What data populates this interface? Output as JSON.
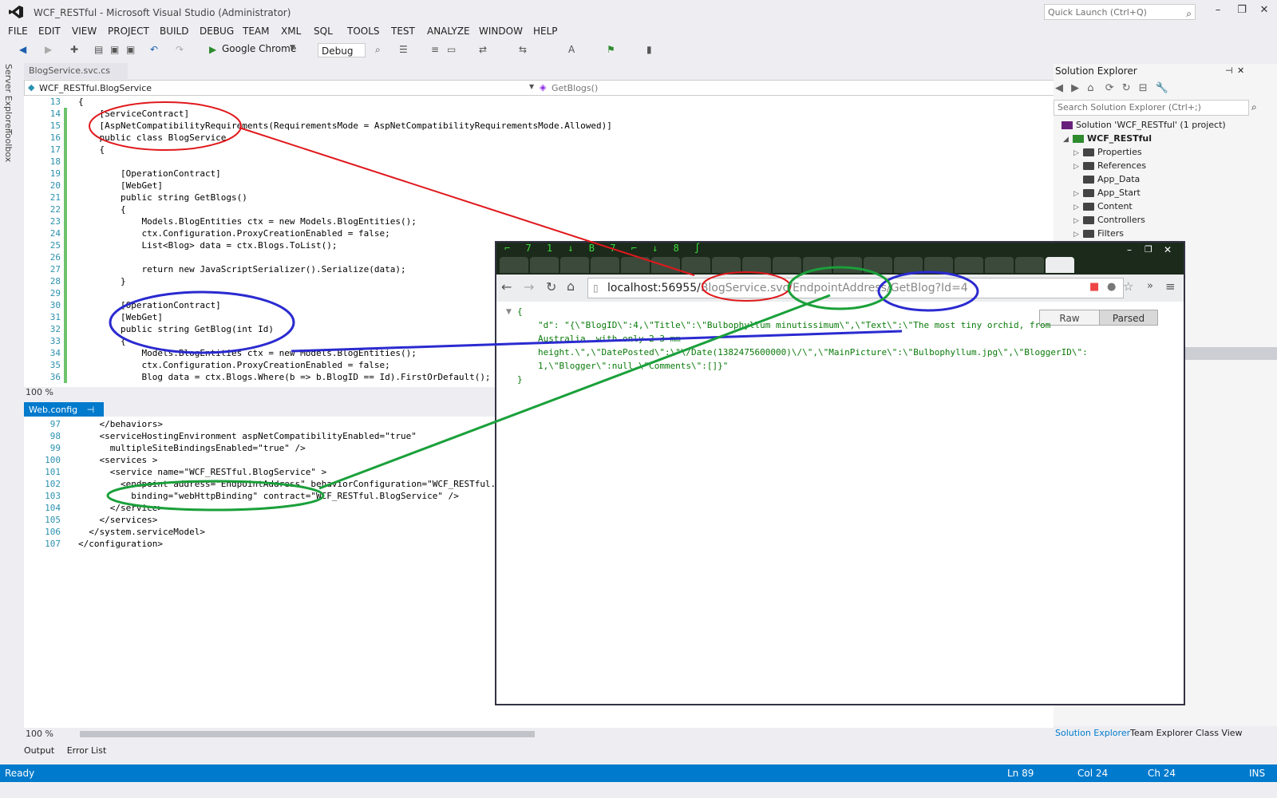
{
  "window": {
    "title": "WCF_RESTful - Microsoft Visual Studio (Administrator)",
    "quick_launch_placeholder": "Quick Launch (Ctrl+Q)"
  },
  "menu": [
    "FILE",
    "EDIT",
    "VIEW",
    "PROJECT",
    "BUILD",
    "DEBUG",
    "TEAM",
    "XML",
    "SQL",
    "TOOLS",
    "TEST",
    "ANALYZE",
    "WINDOW",
    "HELP"
  ],
  "toolbar": {
    "run_target": "Google Chrome",
    "configuration": "Debug"
  },
  "side_labels": [
    "Server Explorer",
    "Toolbox"
  ],
  "editor1": {
    "tab_label": "BlogService.svc.cs",
    "nav_left": "WCF_RESTful.BlogService",
    "nav_right": "GetBlogs()",
    "zoom": "100 %",
    "lines": [
      {
        "n": "13",
        "t": "{"
      },
      {
        "n": "14",
        "t": "    [ServiceContract]"
      },
      {
        "n": "15",
        "t": "    [AspNetCompatibilityRequirements(RequirementsMode = AspNetCompatibilityRequirementsMode.Allowed)]"
      },
      {
        "n": "16",
        "t": "    public class BlogService"
      },
      {
        "n": "17",
        "t": "    {"
      },
      {
        "n": "18",
        "t": ""
      },
      {
        "n": "19",
        "t": "        [OperationContract]"
      },
      {
        "n": "20",
        "t": "        [WebGet]"
      },
      {
        "n": "21",
        "t": "        public string GetBlogs()"
      },
      {
        "n": "22",
        "t": "        {"
      },
      {
        "n": "23",
        "t": "            Models.BlogEntities ctx = new Models.BlogEntities();"
      },
      {
        "n": "24",
        "t": "            ctx.Configuration.ProxyCreationEnabled = false;"
      },
      {
        "n": "25",
        "t": "            List<Blog> data = ctx.Blogs.ToList();"
      },
      {
        "n": "26",
        "t": ""
      },
      {
        "n": "27",
        "t": "            return new JavaScriptSerializer().Serialize(data);"
      },
      {
        "n": "28",
        "t": "        }"
      },
      {
        "n": "29",
        "t": ""
      },
      {
        "n": "30",
        "t": "        [OperationContract]"
      },
      {
        "n": "31",
        "t": "        [WebGet]"
      },
      {
        "n": "32",
        "t": "        public string GetBlog(int Id)"
      },
      {
        "n": "33",
        "t": "        {"
      },
      {
        "n": "34",
        "t": "            Models.BlogEntities ctx = new Models.BlogEntities();"
      },
      {
        "n": "35",
        "t": "            ctx.Configuration.ProxyCreationEnabled = false;"
      },
      {
        "n": "36",
        "t": "            Blog data = ctx.Blogs.Where(b => b.BlogID == Id).FirstOrDefault();"
      }
    ]
  },
  "editor2": {
    "tab_label": "Web.config",
    "zoom": "100 %",
    "lines": [
      {
        "n": "97",
        "t": "    </behaviors>"
      },
      {
        "n": "98",
        "t": "    <serviceHostingEnvironment aspNetCompatibilityEnabled=\"true\""
      },
      {
        "n": "99",
        "t": "      multipleSiteBindingsEnabled=\"true\" />"
      },
      {
        "n": "100",
        "t": "    <services >"
      },
      {
        "n": "101",
        "t": "      <service name=\"WCF_RESTful.BlogService\" >"
      },
      {
        "n": "102",
        "t": "        <endpoint address=\"EndpointAddress\" behaviorConfiguration=\"WCF_RESTful.E"
      },
      {
        "n": "103",
        "t": "          binding=\"webHttpBinding\" contract=\"WCF_RESTful.BlogService\" />"
      },
      {
        "n": "104",
        "t": "      </service>"
      },
      {
        "n": "105",
        "t": "    </services>"
      },
      {
        "n": "106",
        "t": "  </system.serviceModel>"
      },
      {
        "n": "107",
        "t": "</configuration>"
      }
    ]
  },
  "output_tabs": [
    "Output",
    "Error List"
  ],
  "solution_explorer": {
    "title": "Solution Explorer",
    "search_placeholder": "Search Solution Explorer (Ctrl+;)",
    "solution": "Solution 'WCF_RESTful' (1 project)",
    "project": "WCF_RESTful",
    "items": [
      "Properties",
      "References",
      "App_Data",
      "App_Start",
      "Content",
      "Controllers",
      "Filters"
    ],
    "bottom_tabs": [
      "Solution Explorer",
      "Team Explorer",
      "Class View"
    ]
  },
  "browser": {
    "url_host": "localhost:56955/",
    "url_path": "BlogService.svc/EndpointAddress/GetBlog?Id=4",
    "raw_label": "Raw",
    "parsed_label": "Parsed",
    "json_lines": [
      "{",
      "\"d\": \"{\\\"BlogID\\\":4,\\\"Title\\\":\\\"Bulbophyllum minutissimum\\\",\\\"Text\\\":\\\"The most tiny orchid, from",
      "Australia, with only 2-3 mm",
      "height.\\\",\\\"DatePosted\\\":\\\"\\/Date(1382475600000)\\/\\\",\\\"MainPicture\\\":\\\"Bulbophyllum.jpg\\\",\\\"BloggerID\\\":",
      "1,\\\"Blogger\\\":null,\\\"Comments\\\":[]}\"",
      "}"
    ]
  },
  "status_bar": {
    "state": "Ready",
    "line": "Ln 89",
    "col": "Col 24",
    "ch": "Ch 24",
    "mode": "INS"
  },
  "colors": {
    "accent": "#007acc",
    "annotation_red": "#e0181c",
    "annotation_green": "#1aa03a",
    "annotation_blue": "#2a2ad0"
  }
}
